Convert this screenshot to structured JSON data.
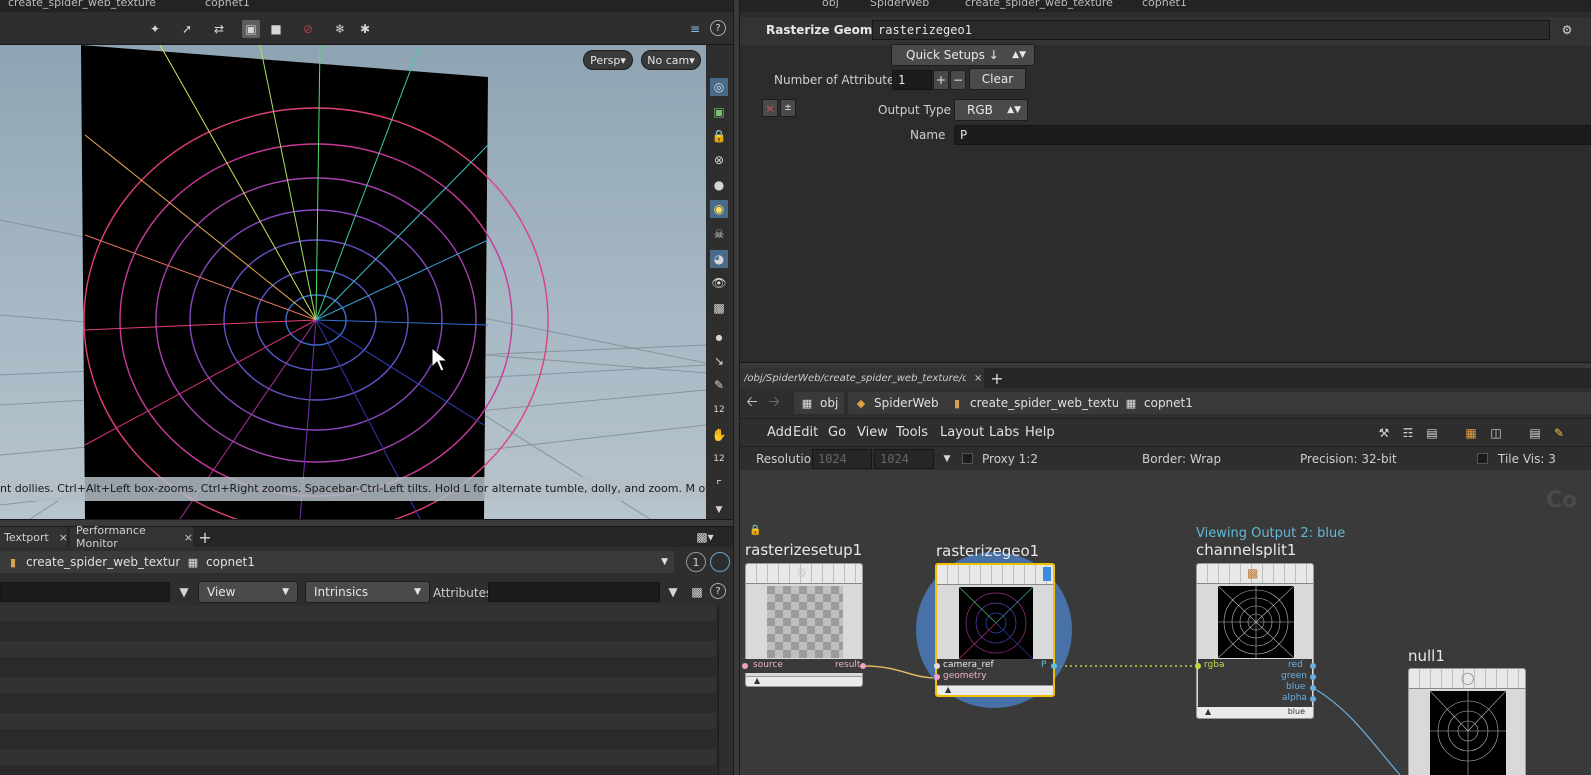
{
  "top_strip": {
    "left_tab_1": "create_spider_web_texture",
    "left_tab_2": "copnet1",
    "right_crumbs": [
      "obj",
      "SpiderWeb",
      "create_spider_web_texture",
      "copnet1"
    ]
  },
  "viewport": {
    "camera_menu": "Persp",
    "cam_menu": "No cam",
    "status_hint": "nt dollies. Ctrl+Alt+Left box-zooms. Ctrl+Right zooms. Spacebar-Ctrl-Left tilts. Hold L for alternate tumble, dolly, and zoom. M or Alt+M for First",
    "side_numbers": [
      "12",
      "12"
    ]
  },
  "spreadsheet": {
    "tabs": [
      "Textport",
      "Performance Monitor"
    ],
    "crumbs": [
      "create_spider_web_texture",
      "copnet1"
    ],
    "page_number": "1",
    "view_menu": "View",
    "intrinsics_menu": "Intrinsics",
    "attributes_label": "Attributes:"
  },
  "params": {
    "node_type": "Rasterize Geometry",
    "node_name": "rasterizegeo1",
    "quick_setups": "Quick Setups ↓",
    "num_attributes_label": "Number of Attributes",
    "num_attributes_value": "1",
    "clear_label": "Clear",
    "output_type_label": "Output Type",
    "output_type_value": "RGB",
    "name_label": "Name",
    "name_value": "P"
  },
  "network": {
    "path_tab": "/obj/SpiderWeb/create_spider_web_texture/copn...",
    "crumbs": [
      "obj",
      "SpiderWeb",
      "create_spider_web_texture",
      "copnet1"
    ],
    "menus": [
      "Add",
      "Edit",
      "Go",
      "View",
      "Tools",
      "Layout",
      "Labs",
      "Help"
    ],
    "resolution_label": "Resolution",
    "res_w": "1024",
    "res_h": "1024",
    "proxy_label": "Proxy 1:2",
    "border_label": "Border: Wrap",
    "precision_label": "Precision: 32-bit",
    "tilevis_label": "Tile Vis: 3",
    "watermark": "Co",
    "viewing_label": "Viewing Output 2: blue",
    "nodes": {
      "rasterizesetup1": {
        "title": "rasterizesetup1",
        "in": "source",
        "out": "result"
      },
      "rasterizegeo1": {
        "title": "rasterizegeo1",
        "in1": "camera_ref",
        "in2": "geometry",
        "out": "P"
      },
      "channelsplit1": {
        "title": "channelsplit1",
        "in": "rgba",
        "outs": [
          "red",
          "green",
          "blue",
          "alpha"
        ],
        "footer": "blue"
      },
      "null1": {
        "title": "null1"
      }
    }
  },
  "colors": {
    "accent_blue": "#4a78b5",
    "selected_yellow": "#f0c000",
    "viewing_cyan": "#62b8d6"
  }
}
